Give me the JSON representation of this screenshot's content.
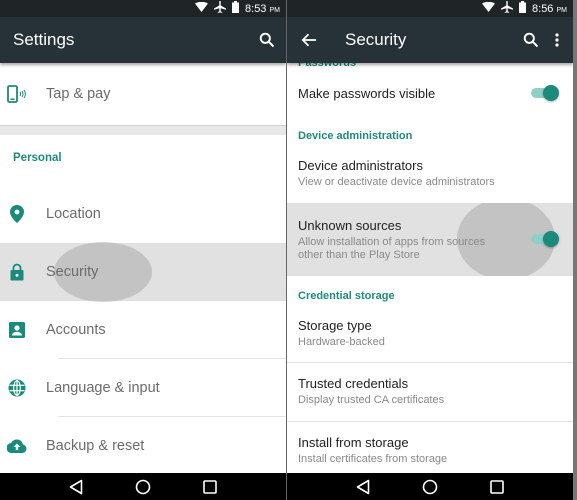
{
  "left": {
    "status": {
      "time": "8:53",
      "ampm": "PM",
      "icons": [
        "wifi-icon",
        "airplane-icon",
        "battery-icon"
      ]
    },
    "appbar": {
      "title": "Settings",
      "actions": [
        "search-icon"
      ]
    },
    "items_top": [
      {
        "label": "Tap & pay",
        "icon": "tap-pay-icon"
      }
    ],
    "section_personal": "Personal",
    "items_personal": [
      {
        "label": "Location",
        "icon": "location-icon"
      },
      {
        "label": "Security",
        "icon": "lock-icon",
        "pressed": true
      },
      {
        "label": "Accounts",
        "icon": "account-icon"
      },
      {
        "label": "Language & input",
        "icon": "globe-icon"
      },
      {
        "label": "Backup & reset",
        "icon": "cloud-upload-icon"
      }
    ]
  },
  "right": {
    "status": {
      "time": "8:56",
      "ampm": "PM",
      "icons": [
        "wifi-icon",
        "airplane-icon",
        "battery-icon"
      ]
    },
    "appbar": {
      "title": "Security",
      "actions": [
        "back-icon",
        "search-icon",
        "more-vert-icon"
      ]
    },
    "sections": {
      "passwords": "Passwords",
      "device_admin": "Device administration",
      "credential_storage": "Credential storage"
    },
    "items": {
      "make_passwords_visible": {
        "title": "Make passwords visible",
        "toggle": true
      },
      "device_administrators": {
        "title": "Device administrators",
        "subtitle": "View or deactivate device administrators"
      },
      "unknown_sources": {
        "title": "Unknown sources",
        "subtitle_line1": "Allow installation of apps from sources",
        "subtitle_line2": "other than the Play Store",
        "toggle": true
      },
      "storage_type": {
        "title": "Storage type",
        "subtitle": "Hardware-backed"
      },
      "trusted_credentials": {
        "title": "Trusted credentials",
        "subtitle": "Display trusted CA certificates"
      },
      "install_from_storage": {
        "title": "Install from storage",
        "subtitle": "Install certificates from storage"
      }
    }
  },
  "navbar": {
    "buttons": [
      "back-nav-icon",
      "home-nav-icon",
      "recents-nav-icon"
    ]
  },
  "colors": {
    "accent": "#1a8a7b",
    "appbar": "#263238",
    "statusbar": "#1f2527"
  }
}
